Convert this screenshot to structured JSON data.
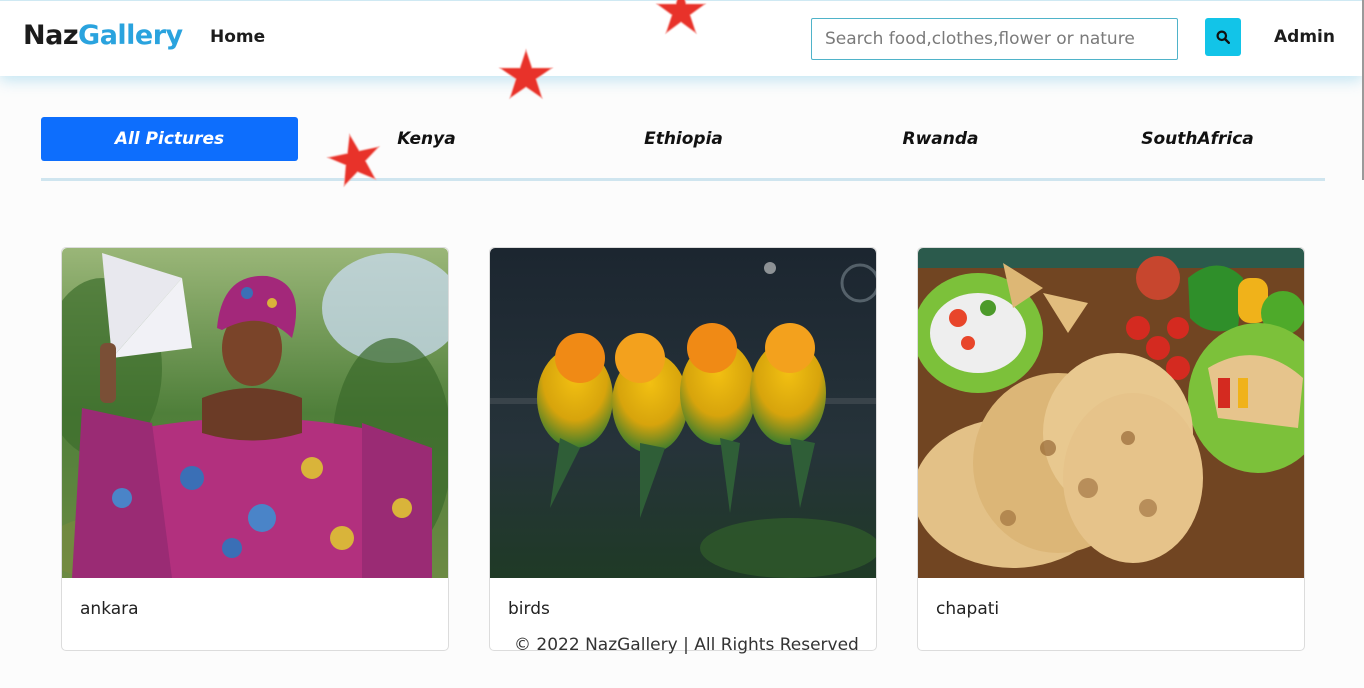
{
  "navbar": {
    "brand_part1": "Naz",
    "brand_part2": "Gallery",
    "home_label": "Home",
    "search_placeholder": "Search food,clothes,flower or nature",
    "search_value": "",
    "admin_label": "Admin"
  },
  "tabs": [
    {
      "label": "All Pictures",
      "active": true
    },
    {
      "label": "Kenya",
      "active": false
    },
    {
      "label": "Ethiopia",
      "active": false
    },
    {
      "label": "Rwanda",
      "active": false
    },
    {
      "label": "SouthAfrica",
      "active": false
    }
  ],
  "cards": [
    {
      "caption": "ankara"
    },
    {
      "caption": "birds"
    },
    {
      "caption": "chapati"
    }
  ],
  "footer": {
    "text": "© 2022 NazGallery | All Rights Reserved"
  },
  "icons": {
    "search": "search-icon",
    "star": "star-icon"
  },
  "colors": {
    "brand_accent": "#2aa3de",
    "active_tab": "#0d6efd",
    "search_button": "#12c4e8",
    "star": "#e8322a"
  }
}
